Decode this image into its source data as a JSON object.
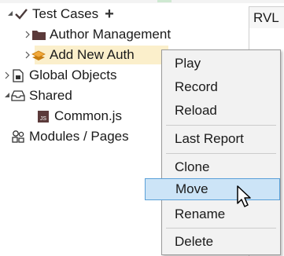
{
  "tree": {
    "test_cases": {
      "label": "Test Cases",
      "add_symbol": "+"
    },
    "author_management": {
      "label": "Author Management"
    },
    "add_new_author": {
      "label": "Add New Auth"
    },
    "global_objects": {
      "label": "Global Objects"
    },
    "shared": {
      "label": "Shared"
    },
    "common_js": {
      "label": "Common.js"
    },
    "modules_pages": {
      "label": "Modules / Pages"
    }
  },
  "right_panel": {
    "tab_label": "RVL"
  },
  "context_menu": {
    "items": [
      "Play",
      "Record",
      "Reload",
      "Last Report",
      "Clone",
      "Move",
      "Rename",
      "Delete"
    ],
    "hovered": "Move"
  },
  "colors": {
    "selection_bg": "#fbefcb",
    "menu_bg": "#f2f2f2",
    "hover_bg": "#cce4f7",
    "hover_border": "#5aa0d8",
    "folder": "#5b3a3a",
    "check": "#4a3a3a"
  },
  "icons": {
    "test_cases": "checkmark-icon",
    "folder": "folder-icon",
    "test_case_item": "layers-icon",
    "global_objects": "document-icon",
    "shared": "tray-icon",
    "common_js": "js-file-icon",
    "modules": "modules-icon"
  }
}
